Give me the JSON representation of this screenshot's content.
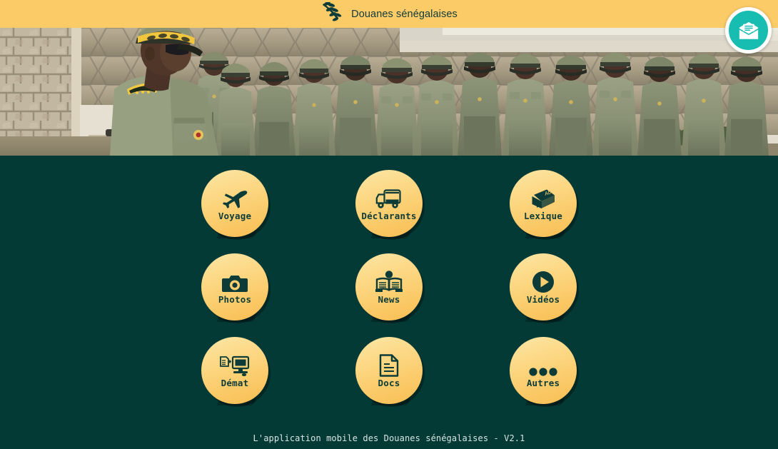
{
  "header": {
    "title": "Douanes sénégalaises",
    "logo_icon": "olive-branch-icon",
    "background_color": "#fbcb68",
    "text_color": "#123a3a"
  },
  "mail_button": {
    "icon": "mail-envelope-icon",
    "label": "",
    "background_color": "#18bdb2",
    "border_color": "#ffffff"
  },
  "hero": {
    "alt": "Officiers des douanes sénégalaises en rang devant un mur de pierre",
    "icon": "customs-officers-photo"
  },
  "theme": {
    "background_color": "#033a36",
    "tile_gradient_top": "#fde6a6",
    "tile_gradient_bottom": "#f8bd52",
    "tile_label_color": "#0d3b38",
    "accent_color": "#18bdb2"
  },
  "menu": {
    "rows": [
      [
        {
          "label": "Voyage",
          "icon": "airplane-icon"
        },
        {
          "label": "Déclarants",
          "icon": "truck-icon"
        },
        {
          "label": "Lexique",
          "icon": "abc-dictionary-book-icon"
        }
      ],
      [
        {
          "label": "Photos",
          "icon": "camera-icon"
        },
        {
          "label": "News",
          "icon": "person-reading-newspaper-icon"
        },
        {
          "label": "Vidéos",
          "icon": "play-circle-icon"
        }
      ],
      [
        {
          "label": "Démat",
          "icon": "computer-document-icon"
        },
        {
          "label": "Docs",
          "icon": "document-file-icon"
        },
        {
          "label": "Autres",
          "icon": "ellipsis-more-icon"
        }
      ]
    ]
  },
  "footer": {
    "text": "L'application mobile des Douanes sénégalaises - V2.1"
  }
}
